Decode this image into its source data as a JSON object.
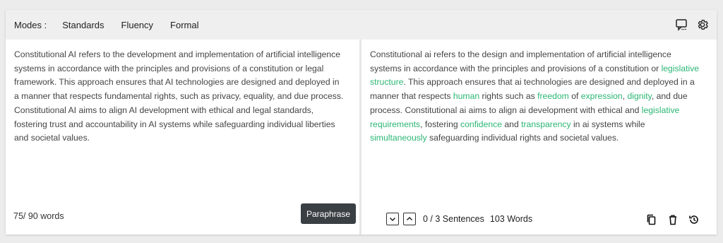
{
  "toolbar": {
    "modes_label": "Modes :",
    "modes": [
      "Standards",
      "Fluency",
      "Formal"
    ],
    "icons": [
      "comment-icon",
      "settings-gear-icon"
    ]
  },
  "input": {
    "text": "Constitutional AI refers to the development and implementation of artificial intelligence systems in accordance with the principles and provisions of a constitution or legal framework. This approach ensures that AI technologies are designed and deployed in a manner that respects fundamental rights, such as privacy, equality, and due process. Constitutional AI aims to align AI development with ethical and legal standards, fostering trust and accountability in AI systems while safeguarding individual liberties and societal values.",
    "word_count": "75/ 90 words",
    "paraphrase_label": "Paraphrase"
  },
  "output": {
    "segments": [
      {
        "t": "Constitutional ai refers to the design and implementation of artificial intelligence systems in accordance with the principles and provisions of a constitution or ",
        "h": false
      },
      {
        "t": "legislative structure",
        "h": true
      },
      {
        "t": ". This approach ensures that ai technologies are designed and deployed in a manner that respects ",
        "h": false
      },
      {
        "t": "human",
        "h": true
      },
      {
        "t": " rights such as ",
        "h": false
      },
      {
        "t": "freedom",
        "h": true
      },
      {
        "t": " of ",
        "h": false
      },
      {
        "t": "expression",
        "h": true
      },
      {
        "t": ", ",
        "h": false
      },
      {
        "t": "dignity",
        "h": true
      },
      {
        "t": ", and due process. Constitutional ai aims to align ai development with ethical and ",
        "h": false
      },
      {
        "t": "legislative requirements",
        "h": true
      },
      {
        "t": ", fostering ",
        "h": false
      },
      {
        "t": "confidence",
        "h": true
      },
      {
        "t": " and ",
        "h": false
      },
      {
        "t": "transparency",
        "h": true
      },
      {
        "t": " in ai systems while ",
        "h": false
      },
      {
        "t": "simultaneously",
        "h": true
      },
      {
        "t": " safeguarding individual rights and societal values.",
        "h": false
      }
    ],
    "sentences": "0 / 3 Sentences",
    "words": "103 Words",
    "icons": [
      "chevron-down-icon",
      "chevron-up-icon",
      "copy-icon",
      "trash-icon",
      "history-icon"
    ]
  },
  "colors": {
    "highlight": "#2bb673",
    "button_bg": "#3a3f44",
    "toolbar_bg": "#efefef"
  }
}
